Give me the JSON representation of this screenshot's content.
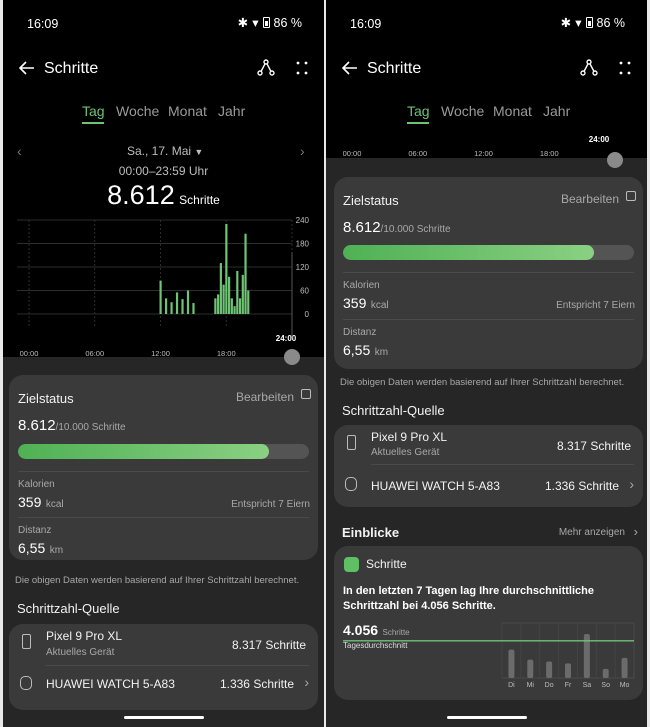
{
  "status": {
    "time": "16:09",
    "battery": "86 %"
  },
  "nav": {
    "title": "Schritte",
    "tabs": [
      "Tag",
      "Woche",
      "Monat",
      "Jahr"
    ],
    "active_tab": "Tag"
  },
  "day": {
    "date": "Sa., 17. Mai",
    "range": "00:00–23:59 Uhr",
    "steps": "8.612",
    "steps_unit": "Schritte"
  },
  "chart_data": {
    "type": "bar",
    "x_ticks": [
      "00:00",
      "06:00",
      "12:00",
      "18:00",
      "24:00"
    ],
    "y_ticks": [
      "240",
      "180",
      "120",
      "60",
      "0"
    ],
    "ylim": [
      0,
      240
    ],
    "hours": [
      12.0,
      12.5,
      13.0,
      13.5,
      14.0,
      14.5,
      15.0,
      17.0,
      17.25,
      17.5,
      17.75,
      18.0,
      18.25,
      18.5,
      18.75,
      19.0,
      19.25,
      19.5,
      19.75,
      20.0
    ],
    "values": [
      85,
      40,
      30,
      55,
      38,
      60,
      28,
      40,
      50,
      130,
      75,
      230,
      95,
      40,
      20,
      110,
      40,
      100,
      205,
      60
    ],
    "color": "#6ec374"
  },
  "goal": {
    "title": "Zielstatus",
    "edit": "Bearbeiten",
    "value": "8.612",
    "target": "/10.000 Schritte",
    "progress": 0.8612,
    "calories_label": "Kalorien",
    "calories": "359",
    "calories_unit": "kcal",
    "calories_note": "Entspricht 7 Eiern",
    "distance_label": "Distanz",
    "distance": "6,55",
    "distance_unit": "km"
  },
  "note": "Die obigen Daten werden basierend auf Ihrer Schrittzahl berechnet.",
  "source": {
    "title": "Schrittzahl-Quelle",
    "devices": [
      {
        "name": "Pixel 9 Pro XL",
        "sub": "Aktuelles Gerät",
        "steps": "8.317 Schritte"
      },
      {
        "name": "HUAWEI WATCH 5-A83",
        "steps": "1.336 Schritte"
      }
    ]
  },
  "insights": {
    "title": "Einblicke",
    "more": "Mehr anzeigen",
    "card_title": "Schritte",
    "text": "In den letzten 7 Tagen lag Ihre durchschnittliche Schrittzahl bei 4.056 Schritte.",
    "avg": "4.056",
    "avg_unit": "Schritte",
    "avg_label": "Tagesdurchschnitt",
    "days": [
      "Di",
      "Mi",
      "Do",
      "Fr",
      "Sa",
      "So",
      "Mo"
    ],
    "day_values": [
      3100,
      2000,
      1800,
      1600,
      4800,
      1000,
      2200
    ]
  },
  "colors": {
    "accent": "#6ec374",
    "background": "#000000",
    "card": "#3a3a3a"
  }
}
